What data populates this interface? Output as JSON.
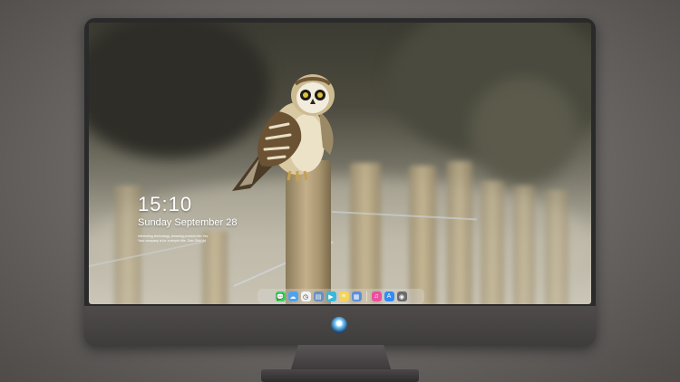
{
  "lockscreen": {
    "time": "15:10",
    "date": "Sunday September 28",
    "notice_line1": "Interesting technology, Amazing product info Yes",
    "notice_line2": "Your company is for a simple title. Zalo Ghfd ltd"
  },
  "dock": {
    "apps": [
      {
        "name": "messages",
        "color": "#3fce5a",
        "glyph": "💬"
      },
      {
        "name": "weather",
        "color": "#4ea2f0",
        "glyph": "☁"
      },
      {
        "name": "clock",
        "color": "#f2f2f2",
        "glyph": "◷"
      },
      {
        "name": "files",
        "color": "#6a8fbf",
        "glyph": "▤"
      },
      {
        "name": "video",
        "color": "#3bb7d8",
        "glyph": "▶"
      },
      {
        "name": "notes",
        "color": "#f5d45a",
        "glyph": "≡"
      },
      {
        "name": "photos",
        "color": "#5e8fd6",
        "glyph": "▦"
      },
      {
        "name": "music",
        "color": "#ec4fa0",
        "glyph": "♫"
      },
      {
        "name": "appstore",
        "color": "#2f8cf5",
        "glyph": "A"
      },
      {
        "name": "camera",
        "color": "#6b6b6b",
        "glyph": "◉"
      }
    ]
  }
}
